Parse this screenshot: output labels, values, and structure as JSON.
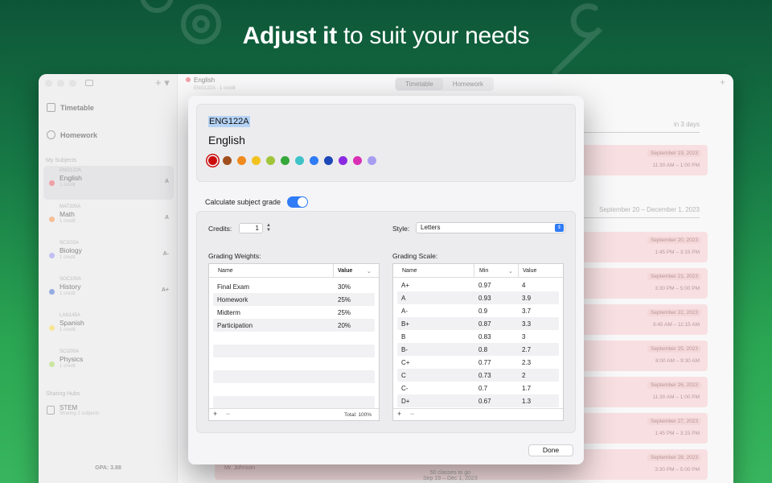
{
  "hero": {
    "bold": "Adjust it",
    "rest": " to suit your needs"
  },
  "window": {
    "sidebar": {
      "nav": [
        {
          "label": "Timetable"
        },
        {
          "label": "Homework"
        }
      ],
      "my_subjects_header": "My Subjects",
      "subjects": [
        {
          "code": "ENG122A",
          "name": "English",
          "credits": "1 credit",
          "grade": "A",
          "color": "#e2535b",
          "active": true
        },
        {
          "code": "MAT200A",
          "name": "Math",
          "credits": "1 credit",
          "grade": "A",
          "color": "#ef8a3d"
        },
        {
          "code": "SCI102A",
          "name": "Biology",
          "credits": "1 credit",
          "grade": "A-",
          "color": "#8f8be6"
        },
        {
          "code": "SOC100A",
          "name": "History",
          "credits": "1 credit",
          "grade": "A+",
          "color": "#3f68c9"
        },
        {
          "code": "LAN145A",
          "name": "Spanish",
          "credits": "1 credit",
          "grade": "",
          "color": "#f0cf3c"
        },
        {
          "code": "SCI200A",
          "name": "Physics",
          "credits": "1 credit",
          "grade": "",
          "color": "#9fcf55"
        }
      ],
      "sharing_header": "Sharing Hubs",
      "hub": {
        "name": "STEM",
        "sub": "Sharing 2 subjects"
      },
      "gpa": "GPA: 3.88"
    },
    "toolbar": {
      "subject": "English",
      "subject_sub": "ENG122A · 1 credit",
      "tabs": [
        "Timetable",
        "Homework"
      ]
    },
    "content": {
      "top_range": "in 3 days",
      "range": "September 20 – December 1, 2023",
      "cards": [
        {
          "date": "September 19, 2023",
          "time": "11:30 AM – 1:00 PM"
        },
        {
          "date": "September 20, 2023",
          "time": "1:45 PM – 3:15 PM"
        },
        {
          "date": "September 21, 2023",
          "time": "3:30 PM – 5:00 PM"
        },
        {
          "date": "September 22, 2023",
          "time": "9:45 AM – 11:15 AM"
        },
        {
          "date": "September 25, 2023",
          "time": "8:00 AM – 9:30 AM"
        },
        {
          "date": "September 26, 2023",
          "time": "11:30 AM – 1:00 PM"
        },
        {
          "date": "September 27, 2023",
          "time": "1:45 PM – 3:15 PM"
        },
        {
          "date": "September 28, 2023",
          "time": "3:30 PM – 5:00 PM"
        }
      ],
      "footer_teacher": "Mr. Johnson",
      "footer_classes": "50 classes to go",
      "footer_range": "Sep 19 – Dec 1, 2023"
    }
  },
  "modal": {
    "subject_code": "ENG122A",
    "subject_name": "English",
    "colors": [
      "#cc0d0d",
      "#a0501e",
      "#f08a1e",
      "#f2c21e",
      "#a0c43a",
      "#36a83a",
      "#3fc2c8",
      "#2f7cf6",
      "#1e48b8",
      "#8a2be2",
      "#d92fb5",
      "#a89ef0"
    ],
    "calc_label": "Calculate subject grade",
    "credits_label": "Credits:",
    "credits_value": "1",
    "style_label": "Style:",
    "style_value": "Letters",
    "weights_title": "Grading Weights:",
    "weights_headers": {
      "name": "Name",
      "value": "Value"
    },
    "weights": [
      {
        "name": "Final Exam",
        "value": "30%"
      },
      {
        "name": "Homework",
        "value": "25%"
      },
      {
        "name": "Midterm",
        "value": "25%"
      },
      {
        "name": "Participation",
        "value": "20%"
      }
    ],
    "weights_total": "Total: 100%",
    "scale_title": "Grading Scale:",
    "scale_headers": {
      "name": "Name",
      "min": "Min",
      "value": "Value"
    },
    "scale": [
      {
        "name": "A+",
        "min": "0.97",
        "value": "4"
      },
      {
        "name": "A",
        "min": "0.93",
        "value": "3.9"
      },
      {
        "name": "A-",
        "min": "0.9",
        "value": "3.7"
      },
      {
        "name": "B+",
        "min": "0.87",
        "value": "3.3"
      },
      {
        "name": "B",
        "min": "0.83",
        "value": "3"
      },
      {
        "name": "B-",
        "min": "0.8",
        "value": "2.7"
      },
      {
        "name": "C+",
        "min": "0.77",
        "value": "2.3"
      },
      {
        "name": "C",
        "min": "0.73",
        "value": "2"
      },
      {
        "name": "C-",
        "min": "0.7",
        "value": "1.7"
      },
      {
        "name": "D+",
        "min": "0.67",
        "value": "1.3"
      }
    ],
    "done_label": "Done"
  }
}
